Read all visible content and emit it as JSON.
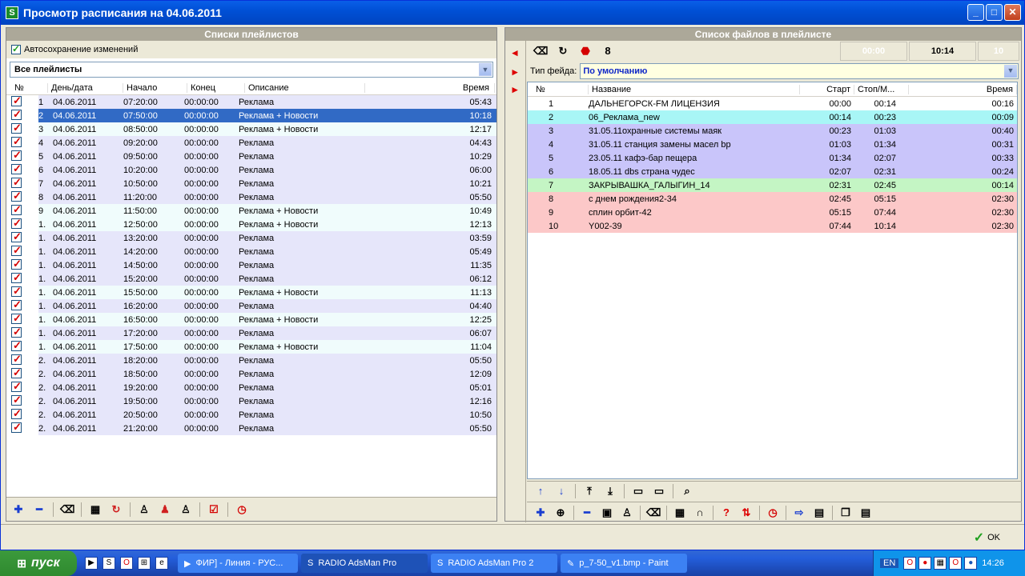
{
  "window": {
    "title": "Просмотр расписания на 04.06.2011",
    "min": "_",
    "max": "□",
    "close": "✕",
    "app_icon": "S"
  },
  "left": {
    "header": "Списки плейлистов",
    "autosave": "Автосохранение изменений",
    "filter": "Все плейлисты",
    "cols": [
      "№",
      "День/дата",
      "Начало",
      "Конец",
      "Описание",
      "Время"
    ],
    "rows": [
      {
        "n": "1",
        "date": "04.06.2011",
        "start": "07:20:00",
        "end": "00:00:00",
        "desc": "Реклама",
        "time": "05:43",
        "bg": "bg1"
      },
      {
        "n": "2",
        "date": "04.06.2011",
        "start": "07:50:00",
        "end": "00:00:00",
        "desc": "Реклама + Новости",
        "time": "10:18",
        "bg": "bgsel"
      },
      {
        "n": "3",
        "date": "04.06.2011",
        "start": "08:50:00",
        "end": "00:00:00",
        "desc": "Реклама + Новости",
        "time": "12:17",
        "bg": "bg2"
      },
      {
        "n": "4",
        "date": "04.06.2011",
        "start": "09:20:00",
        "end": "00:00:00",
        "desc": "Реклама",
        "time": "04:43",
        "bg": "bg1"
      },
      {
        "n": "5",
        "date": "04.06.2011",
        "start": "09:50:00",
        "end": "00:00:00",
        "desc": "Реклама",
        "time": "10:29",
        "bg": "bg1"
      },
      {
        "n": "6",
        "date": "04.06.2011",
        "start": "10:20:00",
        "end": "00:00:00",
        "desc": "Реклама",
        "time": "06:00",
        "bg": "bg1"
      },
      {
        "n": "7",
        "date": "04.06.2011",
        "start": "10:50:00",
        "end": "00:00:00",
        "desc": "Реклама",
        "time": "10:21",
        "bg": "bg1"
      },
      {
        "n": "8",
        "date": "04.06.2011",
        "start": "11:20:00",
        "end": "00:00:00",
        "desc": "Реклама",
        "time": "05:50",
        "bg": "bg1"
      },
      {
        "n": "9",
        "date": "04.06.2011",
        "start": "11:50:00",
        "end": "00:00:00",
        "desc": "Реклама + Новости",
        "time": "10:49",
        "bg": "bg2"
      },
      {
        "n": "1.",
        "date": "04.06.2011",
        "start": "12:50:00",
        "end": "00:00:00",
        "desc": "Реклама + Новости",
        "time": "12:13",
        "bg": "bg2"
      },
      {
        "n": "1.",
        "date": "04.06.2011",
        "start": "13:20:00",
        "end": "00:00:00",
        "desc": "Реклама",
        "time": "03:59",
        "bg": "bg1"
      },
      {
        "n": "1.",
        "date": "04.06.2011",
        "start": "14:20:00",
        "end": "00:00:00",
        "desc": "Реклама",
        "time": "05:49",
        "bg": "bg1"
      },
      {
        "n": "1.",
        "date": "04.06.2011",
        "start": "14:50:00",
        "end": "00:00:00",
        "desc": "Реклама",
        "time": "11:35",
        "bg": "bg1"
      },
      {
        "n": "1.",
        "date": "04.06.2011",
        "start": "15:20:00",
        "end": "00:00:00",
        "desc": "Реклама",
        "time": "06:12",
        "bg": "bg1"
      },
      {
        "n": "1.",
        "date": "04.06.2011",
        "start": "15:50:00",
        "end": "00:00:00",
        "desc": "Реклама + Новости",
        "time": "11:13",
        "bg": "bg2"
      },
      {
        "n": "1.",
        "date": "04.06.2011",
        "start": "16:20:00",
        "end": "00:00:00",
        "desc": "Реклама",
        "time": "04:40",
        "bg": "bg1"
      },
      {
        "n": "1.",
        "date": "04.06.2011",
        "start": "16:50:00",
        "end": "00:00:00",
        "desc": "Реклама + Новости",
        "time": "12:25",
        "bg": "bg2"
      },
      {
        "n": "1.",
        "date": "04.06.2011",
        "start": "17:20:00",
        "end": "00:00:00",
        "desc": "Реклама",
        "time": "06:07",
        "bg": "bg1"
      },
      {
        "n": "1.",
        "date": "04.06.2011",
        "start": "17:50:00",
        "end": "00:00:00",
        "desc": "Реклама + Новости",
        "time": "11:04",
        "bg": "bg2"
      },
      {
        "n": "2.",
        "date": "04.06.2011",
        "start": "18:20:00",
        "end": "00:00:00",
        "desc": "Реклама",
        "time": "05:50",
        "bg": "bg1"
      },
      {
        "n": "2.",
        "date": "04.06.2011",
        "start": "18:50:00",
        "end": "00:00:00",
        "desc": "Реклама",
        "time": "12:09",
        "bg": "bg1"
      },
      {
        "n": "2.",
        "date": "04.06.2011",
        "start": "19:20:00",
        "end": "00:00:00",
        "desc": "Реклама",
        "time": "05:01",
        "bg": "bg1"
      },
      {
        "n": "2.",
        "date": "04.06.2011",
        "start": "19:50:00",
        "end": "00:00:00",
        "desc": "Реклама",
        "time": "12:16",
        "bg": "bg1"
      },
      {
        "n": "2.",
        "date": "04.06.2011",
        "start": "20:50:00",
        "end": "00:00:00",
        "desc": "Реклама",
        "time": "10:50",
        "bg": "bg1"
      },
      {
        "n": "2.",
        "date": "04.06.2011",
        "start": "21:20:00",
        "end": "00:00:00",
        "desc": "Реклама",
        "time": "05:50",
        "bg": "bg1"
      }
    ]
  },
  "right": {
    "header": "Список файлов в плейлисте",
    "time1": "00:00",
    "time2": "10:14",
    "count": "10",
    "fade_label": "Тип фейда:",
    "fade_value": "По умолчанию",
    "cols": [
      "№",
      "Название",
      "Старт",
      "Стоп/М...",
      "Время"
    ],
    "rows": [
      {
        "n": "1",
        "name": "ДАЛЬНЕГОРСК-FM ЛИЦЕНЗИЯ",
        "start": "00:00",
        "stop": "00:14",
        "time": "00:16",
        "bg": ""
      },
      {
        "n": "2",
        "name": "06_Реклама_new",
        "start": "00:14",
        "stop": "00:23",
        "time": "00:09",
        "bg": "cyan"
      },
      {
        "n": "3",
        "name": "31.05.11охранные системы маяк",
        "start": "00:23",
        "stop": "01:03",
        "time": "00:40",
        "bg": "blue"
      },
      {
        "n": "4",
        "name": "31.05.11 станция замены масел bp",
        "start": "01:03",
        "stop": "01:34",
        "time": "00:31",
        "bg": "blue"
      },
      {
        "n": "5",
        "name": "23.05.11 кафэ-бар пещера",
        "start": "01:34",
        "stop": "02:07",
        "time": "00:33",
        "bg": "blue"
      },
      {
        "n": "6",
        "name": "18.05.11 dbs страна чудес",
        "start": "02:07",
        "stop": "02:31",
        "time": "00:24",
        "bg": "blue"
      },
      {
        "n": "7",
        "name": "ЗАКРЫВАШКА_ГАЛЫГИН_14",
        "start": "02:31",
        "stop": "02:45",
        "time": "00:14",
        "bg": "green"
      },
      {
        "n": "8",
        "name": "с днем рождения2-34",
        "start": "02:45",
        "stop": "05:15",
        "time": "02:30",
        "bg": "pink"
      },
      {
        "n": "9",
        "name": "сплин орбит-42",
        "start": "05:15",
        "stop": "07:44",
        "time": "02:30",
        "bg": "pink"
      },
      {
        "n": "10",
        "name": "Y002-39",
        "start": "07:44",
        "stop": "10:14",
        "time": "02:30",
        "bg": "pink"
      }
    ]
  },
  "ok_label": "OK",
  "taskbar": {
    "start": "пуск",
    "tasks": [
      "ФИР] - Линия - РУС...",
      "RADIO AdsMan Pro",
      "RADIO AdsMan Pro 2",
      "p_7-50_v1.bmp - Paint"
    ],
    "lang": "EN",
    "clock": "14:26"
  }
}
